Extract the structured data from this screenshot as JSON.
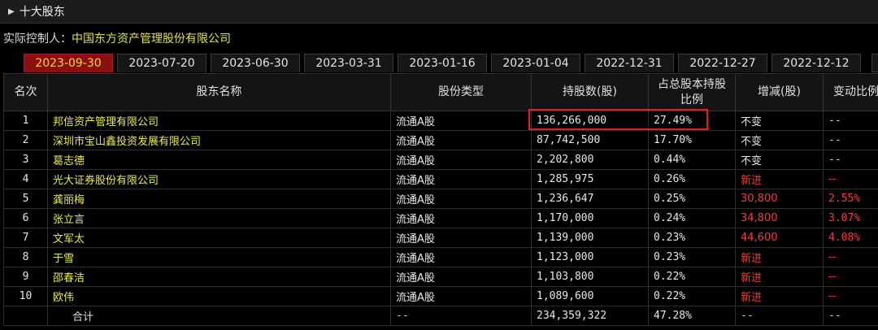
{
  "header": {
    "title": "十大股东"
  },
  "controller": {
    "label": "实际控制人：",
    "value": "中国东方资产管理股份有限公司"
  },
  "tabs": [
    "2023-09-30",
    "2023-07-20",
    "2023-06-30",
    "2023-03-31",
    "2023-01-16",
    "2023-01-04",
    "2022-12-31",
    "2022-12-27",
    "2022-12-12"
  ],
  "active_tab": 0,
  "table": {
    "headers": {
      "rank": "名次",
      "name": "股东名称",
      "type": "股份类型",
      "shares": "持股数(股)",
      "ratio_line1": "占总股本持股",
      "ratio_line2": "比例",
      "change": "增减(股)",
      "change_ratio": "变动比例"
    },
    "rows": [
      {
        "rank": "1",
        "name": "邦信资产管理有限公司",
        "type": "流通A股",
        "shares": "136,266,000",
        "ratio": "27.49%",
        "change": "不变",
        "change_ratio": "--",
        "style": "same"
      },
      {
        "rank": "2",
        "name": "深圳市宝山鑫投资发展有限公司",
        "type": "流通A股",
        "shares": "87,742,500",
        "ratio": "17.70%",
        "change": "不变",
        "change_ratio": "--",
        "style": "same"
      },
      {
        "rank": "3",
        "name": "葛志德",
        "type": "流通A股",
        "shares": "2,202,800",
        "ratio": "0.44%",
        "change": "不变",
        "change_ratio": "--",
        "style": "same"
      },
      {
        "rank": "4",
        "name": "光大证券股份有限公司",
        "type": "流通A股",
        "shares": "1,285,975",
        "ratio": "0.26%",
        "change": "新进",
        "change_ratio": "--",
        "style": "new"
      },
      {
        "rank": "5",
        "name": "龚丽梅",
        "type": "流通A股",
        "shares": "1,236,647",
        "ratio": "0.25%",
        "change": "30,800",
        "change_ratio": "2.55%",
        "style": "inc"
      },
      {
        "rank": "6",
        "name": "张立言",
        "type": "流通A股",
        "shares": "1,170,000",
        "ratio": "0.24%",
        "change": "34,800",
        "change_ratio": "3.07%",
        "style": "inc"
      },
      {
        "rank": "7",
        "name": "文军太",
        "type": "流通A股",
        "shares": "1,139,000",
        "ratio": "0.23%",
        "change": "44,600",
        "change_ratio": "4.08%",
        "style": "inc"
      },
      {
        "rank": "8",
        "name": "于雪",
        "type": "流通A股",
        "shares": "1,123,000",
        "ratio": "0.23%",
        "change": "新进",
        "change_ratio": "--",
        "style": "new"
      },
      {
        "rank": "9",
        "name": "邵春洁",
        "type": "流通A股",
        "shares": "1,103,800",
        "ratio": "0.22%",
        "change": "新进",
        "change_ratio": "--",
        "style": "new"
      },
      {
        "rank": "10",
        "name": "欧伟",
        "type": "流通A股",
        "shares": "1,089,600",
        "ratio": "0.22%",
        "change": "新进",
        "change_ratio": "--",
        "style": "new"
      }
    ],
    "total": {
      "label": "合计",
      "type": "--",
      "shares": "234,359,322",
      "ratio": "47.28%",
      "change": "--",
      "change_ratio": "--"
    }
  },
  "colors": {
    "active_tab_bg": "#8a1010",
    "name_yellow": "#e8e860",
    "red": "#f03c3c",
    "highlight": "#e02020"
  }
}
